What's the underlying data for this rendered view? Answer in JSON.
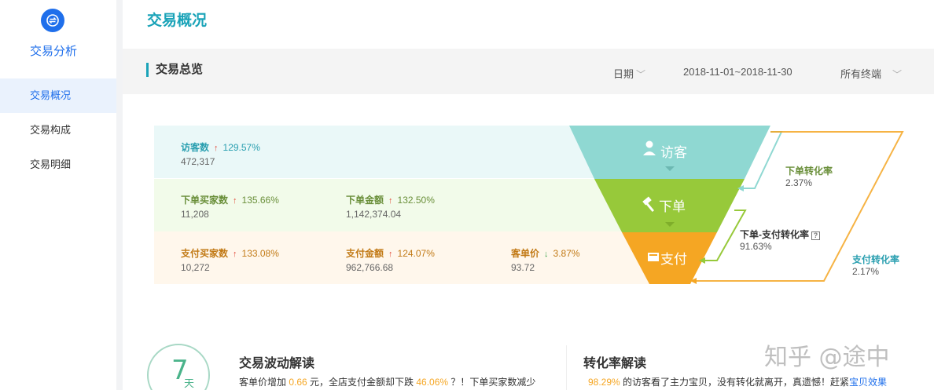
{
  "sidebar": {
    "app_title": "交易分析",
    "items": [
      {
        "label": "交易概况",
        "active": true
      },
      {
        "label": "交易构成",
        "active": false
      },
      {
        "label": "交易明细",
        "active": false
      }
    ]
  },
  "page_title": "交易概况",
  "toolbar": {
    "section_title": "交易总览",
    "date_label": "日期",
    "date_range": "2018-11-01~2018-11-30",
    "terminal_label": "所有终端"
  },
  "funnel": {
    "visitor": {
      "label": "访客数",
      "change": "129.57%",
      "direction": "up",
      "value": "472,317"
    },
    "order": {
      "buyers": {
        "label": "下单买家数",
        "change": "135.66%",
        "direction": "up",
        "value": "11,208"
      },
      "amount": {
        "label": "下单金额",
        "change": "132.50%",
        "direction": "up",
        "value": "1,142,374.04"
      }
    },
    "pay": {
      "buyers": {
        "label": "支付买家数",
        "change": "133.08%",
        "direction": "up",
        "value": "10,272"
      },
      "amount": {
        "label": "支付金额",
        "change": "124.07%",
        "direction": "up",
        "value": "962,766.68"
      },
      "unit_price": {
        "label": "客单价",
        "change": "3.87%",
        "direction": "down",
        "value": "93.72"
      }
    },
    "stages": [
      "访客",
      "下单",
      "支付"
    ],
    "stage_colors": [
      "#8fd8d2",
      "#97c93a",
      "#f5a623"
    ],
    "conversions": {
      "visit_to_order": {
        "label": "下单转化率",
        "value": "2.37%"
      },
      "order_to_pay": {
        "label": "下单-支付转化率",
        "value": "91.63%"
      },
      "visit_to_pay": {
        "label": "支付转化率",
        "value": "2.17%"
      }
    }
  },
  "cards": {
    "days_num": "7",
    "days_unit": "天",
    "fluctuation": {
      "title": "交易波动解读",
      "text_a": "客单价增加 ",
      "hl_a": "0.66",
      "text_b": " 元，全店支付金额却下跌 ",
      "hl_b": "46.06%",
      "text_c": " ？！下单买家数减少"
    },
    "conversion": {
      "title": "转化率解读",
      "hl_a": "98.29%",
      "text_a": " 的访客看了主力宝贝，没有转化就离开，真遗憾！赶紧",
      "link": "宝贝效果"
    }
  },
  "watermark": "知乎 @途中"
}
